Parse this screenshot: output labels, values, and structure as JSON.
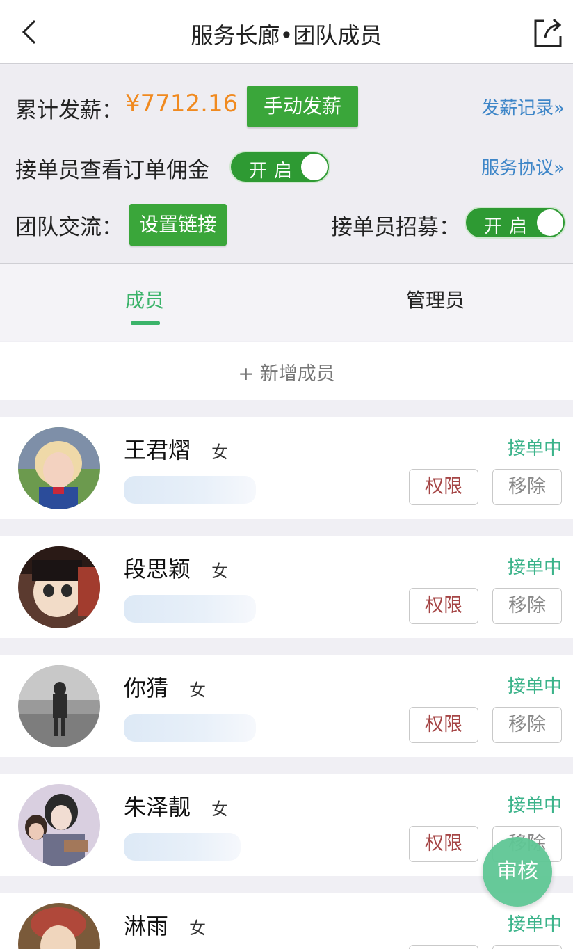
{
  "header": {
    "title": "服务长廊•团队成员",
    "back_icon": "chevron-left-icon",
    "share_icon": "share-icon"
  },
  "settings": {
    "total_pay_label": "累计发薪：",
    "total_pay_amount": "¥7712.16",
    "manual_pay_button": "手动发薪",
    "pay_records_link": "发薪记录»",
    "view_commission_label": "接单员查看订单佣金",
    "view_commission_toggle": "开启",
    "service_agreement_link": "服务协议»",
    "team_chat_label": "团队交流：",
    "set_link_button": "设置链接",
    "recruit_label": "接单员招募：",
    "recruit_toggle": "开启"
  },
  "tabs": [
    {
      "label": "成员",
      "active": true
    },
    {
      "label": "管理员",
      "active": false
    }
  ],
  "add_member": "+ 新增成员",
  "members": [
    {
      "name": "王君熠",
      "gender": "女",
      "status": "接单中",
      "perm_button": "权限",
      "remove_button": "移除"
    },
    {
      "name": "段思颖",
      "gender": "女",
      "status": "接单中",
      "perm_button": "权限",
      "remove_button": "移除"
    },
    {
      "name": "你猜",
      "gender": "女",
      "status": "接单中",
      "perm_button": "权限",
      "remove_button": "移除"
    },
    {
      "name": "朱泽靓",
      "gender": "女",
      "status": "接单中",
      "perm_button": "权限",
      "remove_button": "移除"
    },
    {
      "name": "淋雨",
      "gender": "女",
      "status": "接单中"
    }
  ],
  "fab_label": "审核",
  "colors": {
    "accent_green": "#3aa63a",
    "tab_active": "#3bb36a",
    "status_teal": "#3bb38a",
    "amount_orange": "#f08a20",
    "link_blue": "#3e86c8",
    "perm_red": "#a54545"
  }
}
